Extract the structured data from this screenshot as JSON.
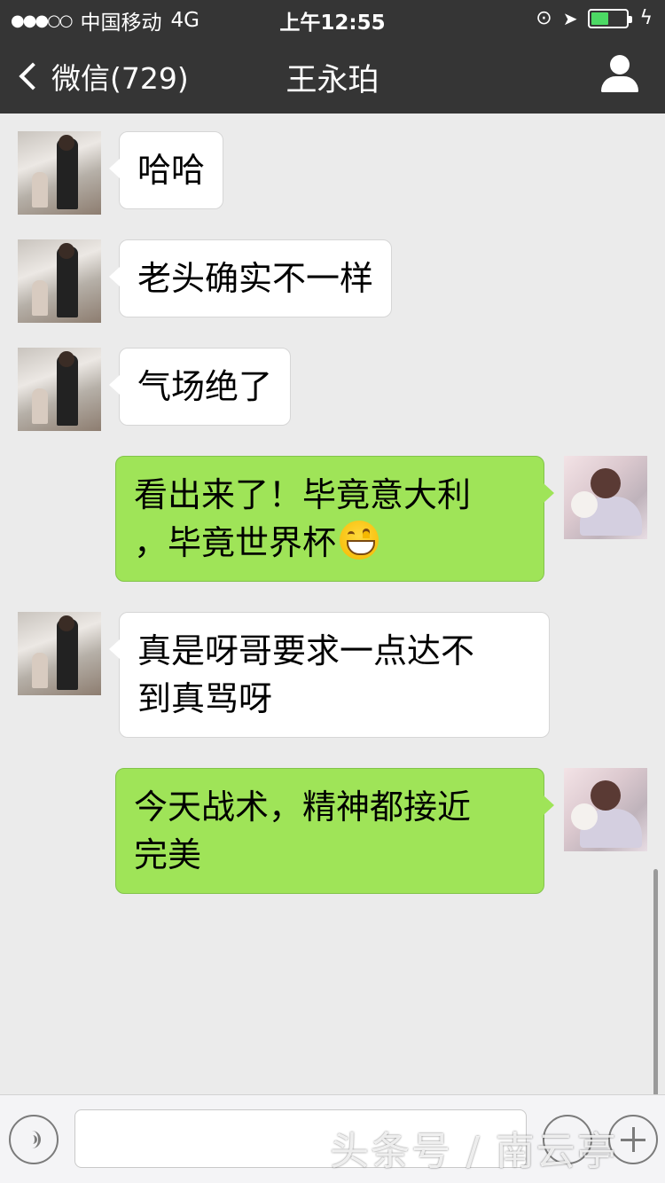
{
  "status_bar": {
    "signal": "●●●○○",
    "carrier": "中国移动",
    "network": "4G",
    "time": "上午12:55",
    "battery_level": 0.45,
    "battery_color": "#4cd964"
  },
  "nav": {
    "back_label": "微信(729)",
    "title": "王永珀",
    "profile_icon": "user-icon"
  },
  "messages": [
    {
      "sender": "contact",
      "text": "哈哈"
    },
    {
      "sender": "contact",
      "text": "老头确实不一样"
    },
    {
      "sender": "contact",
      "text": "气场绝了"
    },
    {
      "sender": "me",
      "line1": "看出来了！毕竟意大利",
      "line2": "，毕竟世界杯",
      "emoji": "grin-emoji"
    },
    {
      "sender": "contact",
      "line1": "真是呀哥要求一点达不",
      "line2": "到真骂呀"
    },
    {
      "sender": "me",
      "line1": "今天战术，精神都接近",
      "line2": "完美"
    }
  ],
  "input_bar": {
    "voice_icon": "voice-icon",
    "emoji_icon": "emoji-icon",
    "plus_icon": "plus-icon"
  },
  "watermark": "头条号 / 南云亭",
  "colors": {
    "header_bg": "#353535",
    "chat_bg": "#ebebeb",
    "incoming_bubble": "#ffffff",
    "outgoing_bubble": "#9fe458"
  }
}
